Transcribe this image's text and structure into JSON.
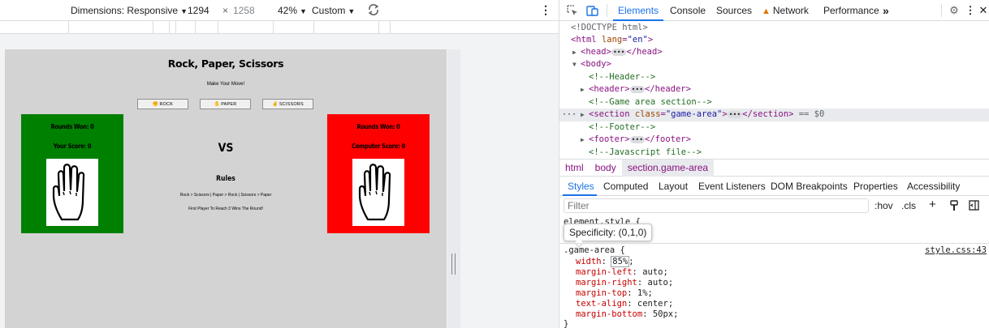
{
  "device_toolbar": {
    "dimensions_label": "Dimensions: Responsive",
    "width_value": "1294",
    "times": "×",
    "height_value": "1258",
    "zoom": "42%",
    "throttle": "Custom",
    "rotate_icon": "rotate-icon",
    "menu_icon": "more-vert-icon"
  },
  "game": {
    "title": "Rock, Paper, Scissors",
    "subtitle": "Make Your Move!",
    "buttons": [
      {
        "label": "ROCK",
        "icon": "rock-hand-icon"
      },
      {
        "label": "PAPER",
        "icon": "paper-hand-icon"
      },
      {
        "label": "SCISSORS",
        "icon": "scissors-hand-icon"
      }
    ],
    "user": {
      "rounds": "Rounds Won: 0",
      "score": "Your Score: 0",
      "color": "#008000"
    },
    "computer": {
      "rounds": "Rounds Won: 0",
      "score": "Computer Score: 0",
      "color": "#ff0000"
    },
    "vs": "VS",
    "rules_title": "Rules",
    "rules_text": "Rock > Scissors | Paper > Rock | Scissors > Paper",
    "rules_note": "First Player To Reach 3 Wins The Round!"
  },
  "devtools": {
    "tabs": [
      "Elements",
      "Console",
      "Sources",
      "Network",
      "Performance"
    ],
    "more_tabs": "»",
    "active_tab": "Elements",
    "dom": {
      "doctype": "<!DOCTYPE html>",
      "html_open": "<html",
      "html_lang_attr": "lang",
      "html_lang_val": "\"en\"",
      "head_open": "<head>",
      "head_close": "</head>",
      "body_open": "<body>",
      "comment_header": "<!--Header-->",
      "header_open": "<header>",
      "header_close": "</header>",
      "comment_game": "<!--Game area section-->",
      "section_open": "<section",
      "section_class_attr": "class",
      "section_class_val": "\"game-area\"",
      "section_close": "</section>",
      "eq0": "== $0",
      "comment_footer": "<!--Footer-->",
      "footer_open": "<footer>",
      "footer_close": "</footer>",
      "comment_js": "<!--Javascript file-->"
    },
    "breadcrumbs": [
      "html",
      "body",
      "section.game-area"
    ],
    "subtabs": [
      "Styles",
      "Computed",
      "Layout",
      "Event Listeners",
      "DOM Breakpoints",
      "Properties",
      "Accessibility"
    ],
    "filter_placeholder": "Filter",
    "filter_tools": {
      "hov": ":hov",
      "cls": ".cls"
    },
    "element_style": "element.style {",
    "tooltip": "Specificity: (0,1,0)",
    "rule": {
      "selector": ".game-area {",
      "source": "style.css:43",
      "declarations": [
        {
          "prop": "width",
          "val": "85%"
        },
        {
          "prop": "margin-left",
          "val": "auto"
        },
        {
          "prop": "margin-right",
          "val": "auto"
        },
        {
          "prop": "margin-top",
          "val": "1%"
        },
        {
          "prop": "text-align",
          "val": "center"
        },
        {
          "prop": "margin-bottom",
          "val": "50px"
        }
      ],
      "close": "}"
    }
  }
}
